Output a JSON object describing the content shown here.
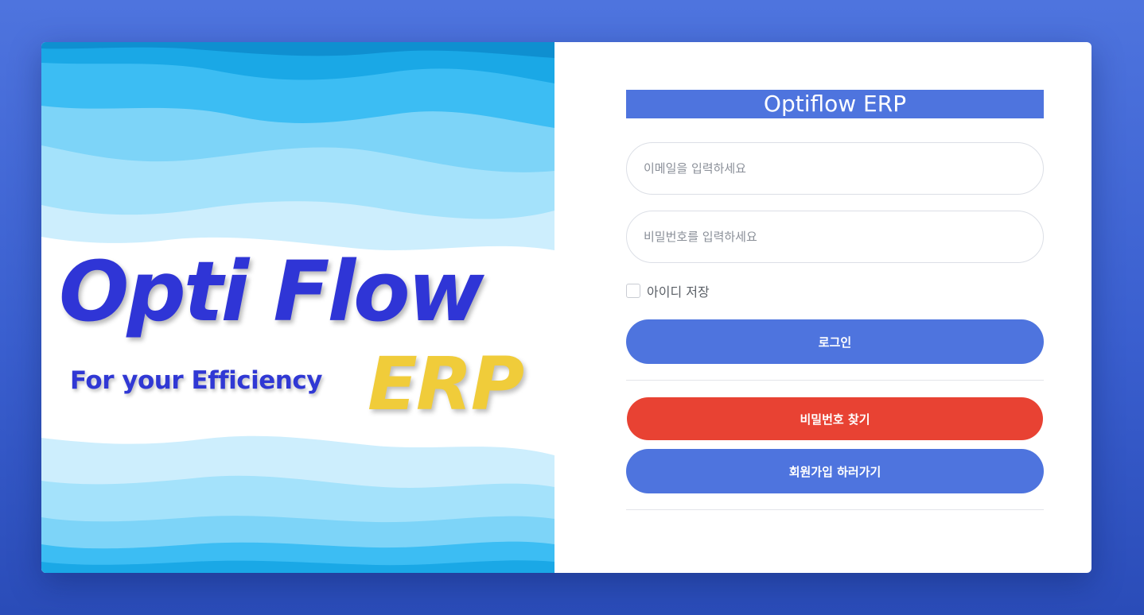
{
  "hero": {
    "logo_main": "Opti Flow",
    "logo_tagline": "For your Efficiency",
    "logo_erp": "ERP",
    "colors": {
      "logo_blue": "#2f35d6",
      "logo_yellow": "#f0cc3a"
    }
  },
  "login": {
    "title": "Optiflow ERP",
    "email_placeholder": "이메일을 입력하세요",
    "email_value": "",
    "password_placeholder": "비밀번호를 입력하세요",
    "password_value": "",
    "remember_label": "아이디 저장",
    "remember_checked": false,
    "login_button": "로그인",
    "forgot_button": "비밀번호 찾기",
    "signup_button": "회원가입 하러가기"
  },
  "colors": {
    "accent": "#4e74de",
    "danger": "#e84233",
    "background_top": "#4e74de",
    "background_bottom": "#2a4cb8"
  }
}
